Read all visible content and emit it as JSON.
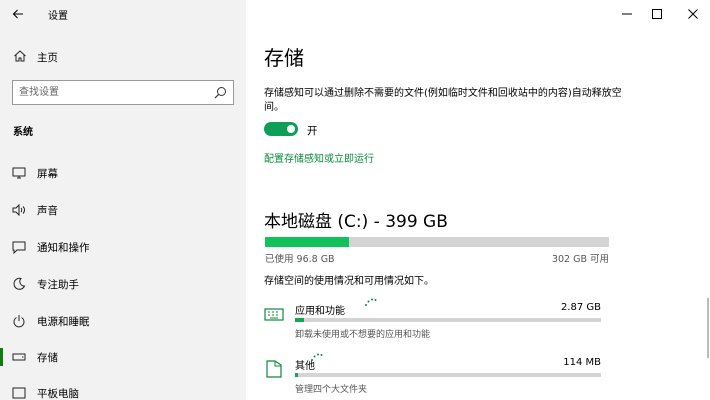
{
  "window": {
    "title": "设置",
    "back_label": "←"
  },
  "sidebar": {
    "home_label": "主页",
    "search_placeholder": "查找设置",
    "section_title": "系统",
    "items": [
      {
        "label": "屏幕",
        "icon": "display-icon"
      },
      {
        "label": "声音",
        "icon": "speaker-icon"
      },
      {
        "label": "通知和操作",
        "icon": "message-icon"
      },
      {
        "label": "专注助手",
        "icon": "moon-icon"
      },
      {
        "label": "电源和睡眠",
        "icon": "power-icon"
      },
      {
        "label": "存储",
        "icon": "storage-icon",
        "selected": true
      },
      {
        "label": "平板电脑",
        "icon": "tablet-icon"
      }
    ]
  },
  "main": {
    "title": "存储",
    "description": "存储感知可以通过删除不需要的文件(例如临时文件和回收站中的内容)自动释放空间。",
    "toggle_label": "开",
    "toggle_on": true,
    "config_link": "配置存储感知或立即运行",
    "disk_title": "本地磁盘 (C:) - 399 GB",
    "used_label": "已使用 96.8 GB",
    "available_label": "302 GB 可用",
    "used_fraction": 0.243,
    "usage_intro": "存储空间的使用情况和可用情况如下。",
    "categories": [
      {
        "name": "应用和功能",
        "size": "2.87 GB",
        "sub": "卸载未使用或不想要的应用和功能",
        "icon": "keyboard-icon",
        "fraction": 0.03
      },
      {
        "name": "其他",
        "size": "114 MB",
        "sub": "管理四个大文件夹",
        "icon": "folder-icon",
        "fraction": 0.01
      }
    ]
  },
  "colors": {
    "accent": "#107c10",
    "toggle": "#0e9f57",
    "disk_fill": "#11c25b",
    "link": "#0b8a3b"
  }
}
